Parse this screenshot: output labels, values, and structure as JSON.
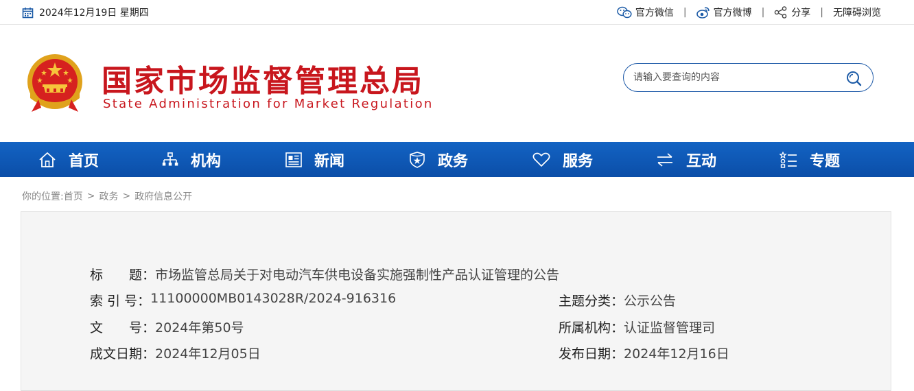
{
  "topbar": {
    "date": "2024年12月19日 星期四",
    "links": [
      {
        "label": "官方微信",
        "icon": "wechat-icon"
      },
      {
        "label": "官方微博",
        "icon": "weibo-icon"
      },
      {
        "label": "分享",
        "icon": "share-icon"
      },
      {
        "label": "无障碍浏览"
      }
    ],
    "separator": "|"
  },
  "header": {
    "title_cn": "国家市场监督管理总局",
    "title_en": "State Administration for Market Regulation",
    "search_placeholder": "请输入要查询的内容"
  },
  "nav": {
    "items": [
      {
        "label": "首页",
        "icon": "home-icon"
      },
      {
        "label": "机构",
        "icon": "org-chart-icon"
      },
      {
        "label": "新闻",
        "icon": "news-icon"
      },
      {
        "label": "政务",
        "icon": "shield-icon"
      },
      {
        "label": "服务",
        "icon": "heart-icon"
      },
      {
        "label": "互动",
        "icon": "exchange-icon"
      },
      {
        "label": "专题",
        "icon": "topic-list-icon"
      }
    ]
  },
  "breadcrumb": {
    "prefix": "你的位置:",
    "items": [
      "首页",
      "政务",
      "政府信息公开"
    ],
    "arrow": ">"
  },
  "info": {
    "title_label": "标　　题：",
    "title": "市场监管总局关于对电动汽车供电设备实施强制性产品认证管理的公告",
    "index_label": "索 引 号：",
    "index": "11100000MB0143028R/2024-916316",
    "docno_label": "文　　号：",
    "docno": "2024年第50号",
    "created_label": "成文日期：",
    "created": "2024年12月05日",
    "topic_label": "主题分类：",
    "topic": "公示公告",
    "org_label": "所属机构：",
    "org": "认证监督管理司",
    "published_label": "发布日期：",
    "published": "2024年12月16日"
  },
  "colors": {
    "brand_red": "#c8161d",
    "nav_blue": "#0b4ea8",
    "panel_bg": "#f5f5f5"
  }
}
